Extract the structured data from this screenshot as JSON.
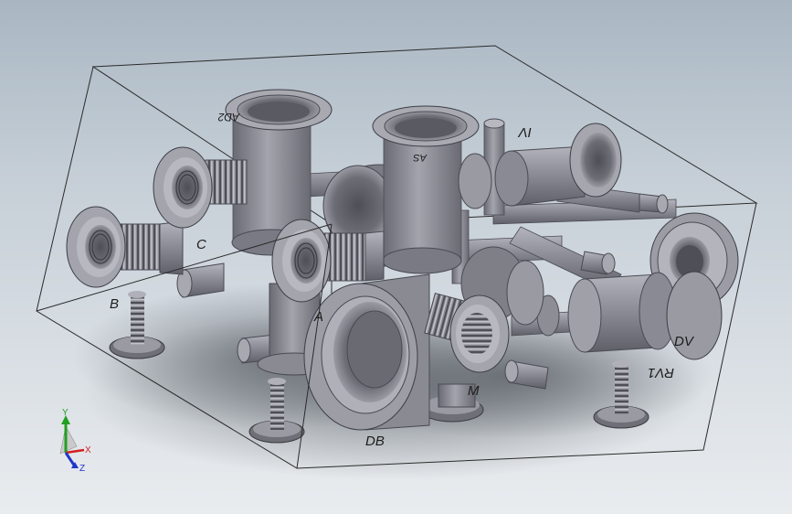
{
  "viewport": {
    "background_top": "#a9b6c2",
    "background_bottom": "#e9ecef",
    "part_color": "#8f8f99"
  },
  "labels": {
    "b": "B",
    "c": "C",
    "a": "A",
    "db": "DB",
    "m": "M",
    "dv": "DV",
    "rv1": "RV1",
    "iv": "IV",
    "ad2": "AD2",
    "as": "AS"
  },
  "triad": {
    "x": "X",
    "y": "Y",
    "z": "Z",
    "x_color": "#d32020",
    "y_color": "#22a022",
    "z_color": "#2036c8"
  }
}
